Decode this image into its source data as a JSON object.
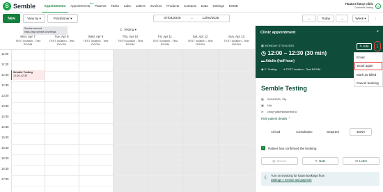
{
  "logo": {
    "text": "Semble",
    "mark": "S"
  },
  "nav": {
    "items": [
      "Appointments",
      "Appointments",
      "Patients",
      "Tasks",
      "Labs",
      "Letters",
      "Invoices",
      "Products",
      "Contacts",
      "Data",
      "Settings",
      "ESME"
    ],
    "badge": "Beta",
    "active_index": 0
  },
  "user": {
    "name": "Huana's fancy clinic",
    "sub": "Cinderella Testing",
    "initials": "H"
  },
  "toolbar": {
    "new_label": "New",
    "view_by_label": "View by ▾",
    "practitioner_label": "Practitioner ▾",
    "date_from": "07/04/2025",
    "date_sep": "→",
    "date_to": "13/04/2025",
    "prev_icon": "←",
    "today_label": "Today",
    "next_icon": "→",
    "week_label": "Week ▾",
    "more_icon": "⋮"
  },
  "tooltip": {
    "line1": "Semble account",
    "line2": "https://app.semble.io/settings"
  },
  "resource": {
    "label": "C. Testing ▾"
  },
  "calendar": {
    "columns": [
      {
        "day": "Mon, Apr 7",
        "loc": "TEST location - Test",
        "room": "ROOM"
      },
      {
        "day": "Tue, Apr 8",
        "loc": "TEST location - Test",
        "room": "ROOM"
      },
      {
        "day": "Wed, Apr 9",
        "loc": "TEST location - Test",
        "room": "ROOM"
      },
      {
        "day": "Thu, Apr 10",
        "loc": "TEST location - Test",
        "room": "ROOM"
      },
      {
        "day": "Fri, Apr 11",
        "loc": "TEST location - Test",
        "room": "ROOM"
      },
      {
        "day": "Sat, Apr 12",
        "loc": "TEST location - Test",
        "room": "ROOM"
      },
      {
        "day": "Sun, Apr 13",
        "loc": "TEST location - Test",
        "room": "ROOM"
      }
    ],
    "hours": [
      "11:00",
      "11:30",
      "12:00",
      "12:30",
      "13:00",
      "13:30",
      "14:00",
      "14:30",
      "15:00",
      "15:30",
      "16:00",
      "16:30",
      "17:00"
    ],
    "event": {
      "title": "Semble Testing",
      "time": "12:00-12:30"
    }
  },
  "panel": {
    "title": "Clinic appointment",
    "close_icon": "×",
    "date": "MONDAY 07/04/2025",
    "time": "12:00 – 12:30 (30 min)",
    "service": "Adults (half hour)",
    "practitioner": "C. Testing",
    "location": "TEST location - Test ROOM",
    "edit_label": "✎ Edit",
    "more_icon": "⋮",
    "patient_name": "Semble Testing",
    "dob": "24/04/2001, 23y",
    "nhs": "N/A",
    "email": "cindy+patient@semble.io",
    "hide_link": "Hide patient details ⌃",
    "statuses": [
      "Arrived",
      "Consultation",
      "Departed"
    ],
    "dna_label": "DNA",
    "confirmed_label": "Patient has confirmed the booking",
    "actions": [
      "Invoice",
      "Note",
      "Letter"
    ],
    "invoice_note": "Turn on invoicing for future bookings from",
    "invoice_link": "Settings > Invoice and payment"
  },
  "menu": {
    "items": [
      "Email",
      "Book again",
      "Mark as billed",
      "Cancel booking"
    ],
    "highlight_index": 1
  },
  "colors": {
    "brand": "#16a34a",
    "panel_header": "#0f4d3a",
    "highlight": "#ef4444"
  }
}
